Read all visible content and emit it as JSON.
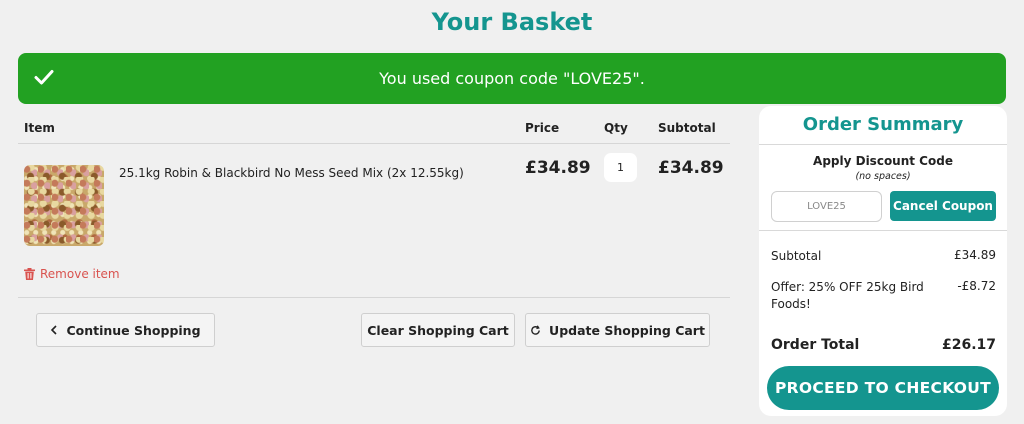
{
  "page": {
    "title": "Your Basket"
  },
  "alert": {
    "message": "You used coupon code \"LOVE25\"."
  },
  "cart": {
    "headers": {
      "item": "Item",
      "price": "Price",
      "qty": "Qty",
      "subtotal": "Subtotal"
    },
    "items": [
      {
        "name": "25.1kg Robin & Blackbird No Mess Seed Mix (2x 12.55kg)",
        "price": "£34.89",
        "qty": "1",
        "subtotal": "£34.89",
        "remove_label": "Remove item"
      }
    ],
    "buttons": {
      "continue": "Continue Shopping",
      "clear": "Clear Shopping Cart",
      "update": "Update Shopping Cart"
    }
  },
  "summary": {
    "title": "Order Summary",
    "discount_title": "Apply Discount Code",
    "discount_hint": "(no spaces)",
    "coupon_value": "LOVE25",
    "cancel_coupon": "Cancel Coupon",
    "subtotal_label": "Subtotal",
    "subtotal_value": "£34.89",
    "offer_label": "Offer: 25% OFF 25kg Bird Foods!",
    "offer_value": "-£8.72",
    "total_label": "Order Total",
    "total_value": "£26.17",
    "checkout": "PROCEED TO CHECKOUT"
  },
  "colors": {
    "accent": "#14958f",
    "success": "#22a122",
    "danger": "#d9534f"
  }
}
